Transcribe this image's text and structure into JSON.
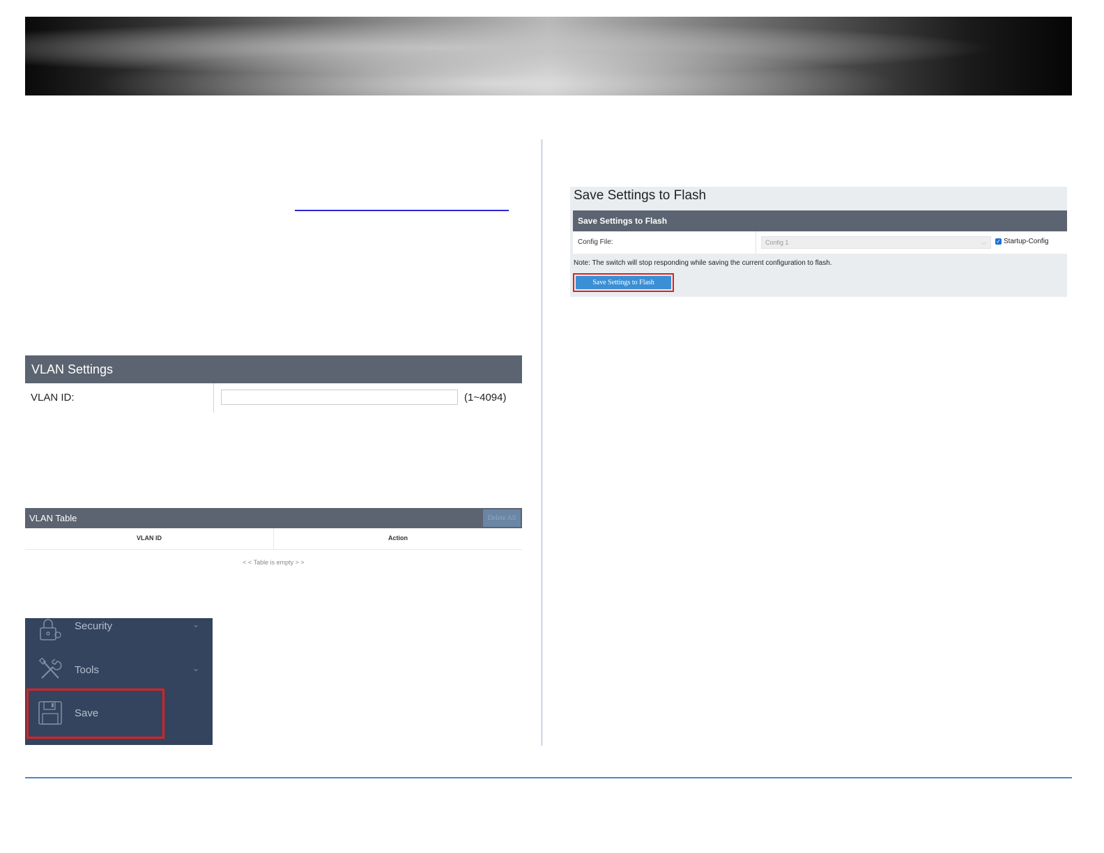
{
  "vlan_settings": {
    "title": "VLAN Settings",
    "vlan_id_label": "VLAN ID:",
    "vlan_id_value": "",
    "vlan_id_hint": "(1~4094)"
  },
  "vlan_table": {
    "title": "VLAN Table",
    "delete_all_label": "Delete All",
    "columns": [
      "VLAN ID",
      "Action"
    ],
    "empty_text": "< < Table is empty > >"
  },
  "sidebar": {
    "items": [
      {
        "label": "Security",
        "icon": "lock-icon"
      },
      {
        "label": "Tools",
        "icon": "tools-icon"
      },
      {
        "label": "Save",
        "icon": "floppy-disk-icon"
      }
    ]
  },
  "save_panel": {
    "page_title": "Save Settings to Flash",
    "section_title": "Save Settings to Flash",
    "config_file_label": "Config File:",
    "config_file_value": "Config 1",
    "startup_config_label": "Startup-Config",
    "startup_config_checked": true,
    "note": "Note: The switch will stop responding while saving the current configuration to flash.",
    "button_label": "Save Settings to Flash"
  },
  "colors": {
    "header_bg": "#5b6470",
    "sidebar_bg": "#34445e",
    "highlight": "#e0201f",
    "primary_button": "#3b8fd4",
    "footer_line": "#4f86c6"
  }
}
